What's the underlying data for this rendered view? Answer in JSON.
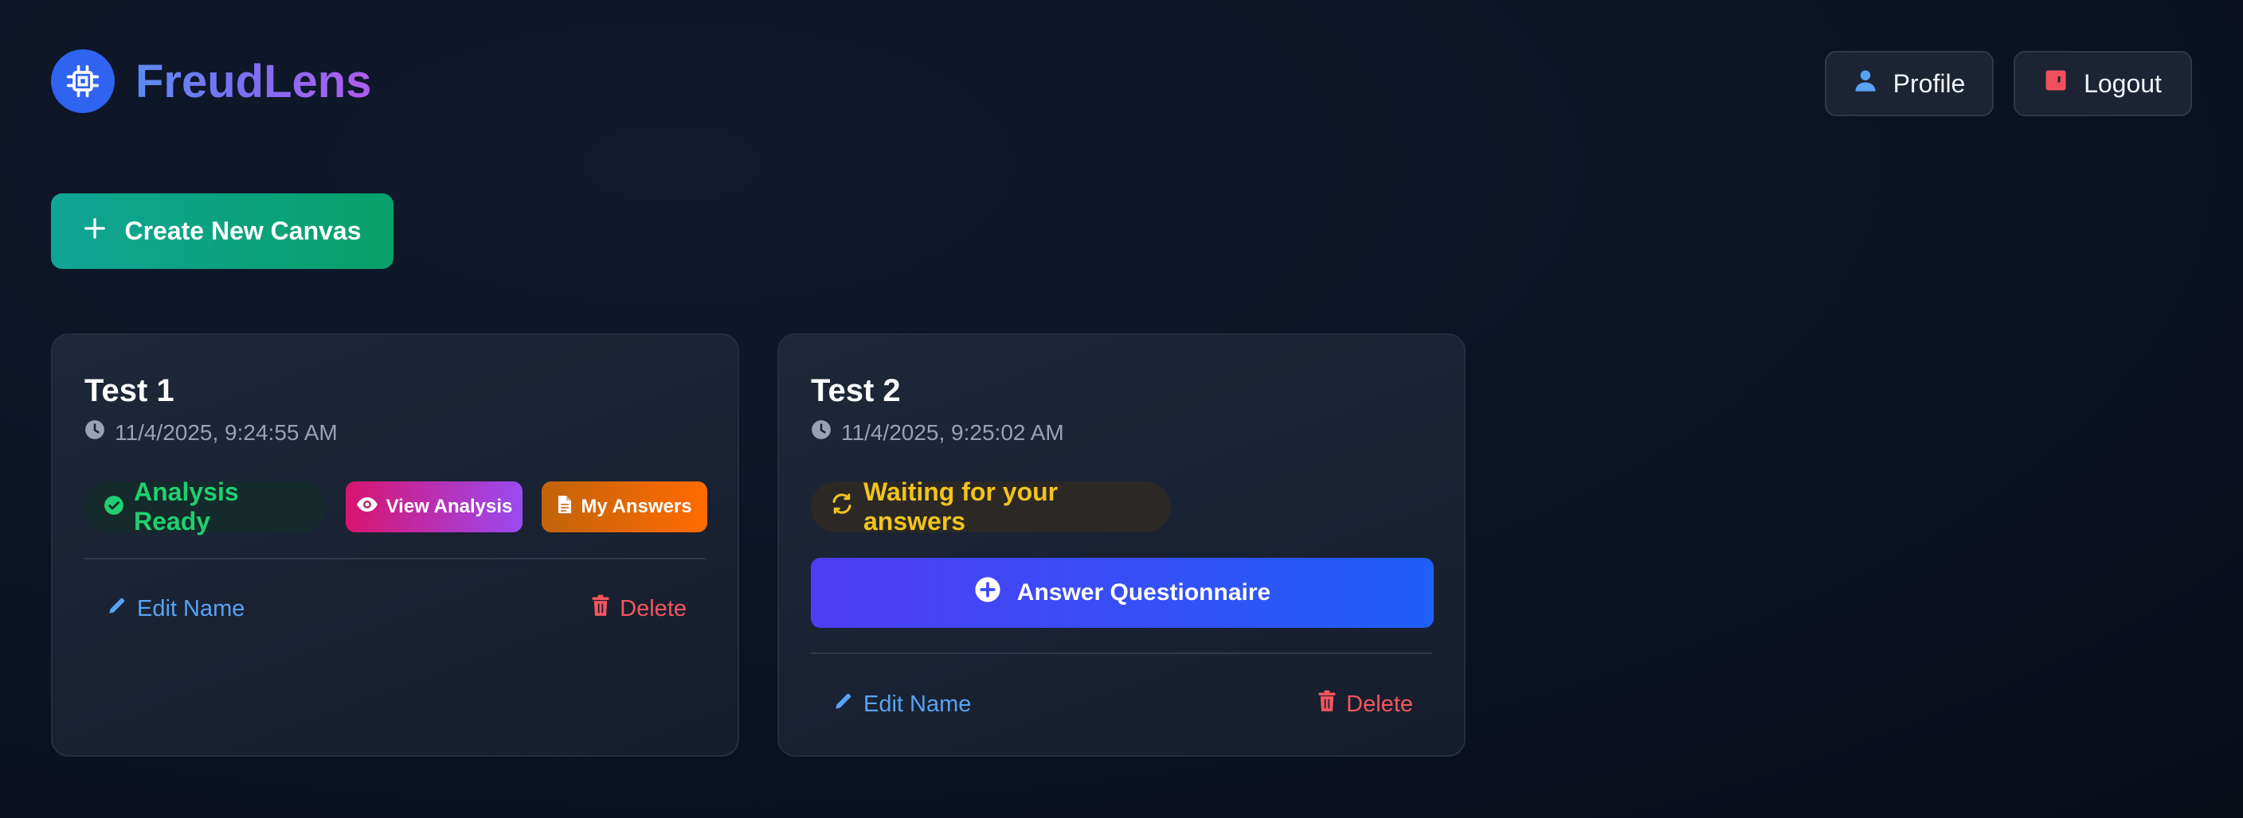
{
  "app": {
    "brand": "FreudLens",
    "logo_icon": "cpu-chip-icon"
  },
  "header": {
    "profile_label": "Profile",
    "logout_label": "Logout"
  },
  "toolbar": {
    "create_label": "Create New Canvas"
  },
  "colors": {
    "accent_blue": "#2f63f0",
    "success_green": "#1fcf71",
    "warning_yellow": "#f2c41b",
    "danger_red": "#f5565d",
    "link_blue": "#58a3f5"
  },
  "canvases": [
    {
      "title": "Test 1",
      "date": "11/4/2025, 9:24:55 AM",
      "status": "Analysis Ready",
      "status_icon": "check-circle-icon",
      "view_analysis_label": "View Analysis",
      "my_answers_label": "My Answers",
      "edit_label": "Edit Name",
      "delete_label": "Delete"
    },
    {
      "title": "Test 2",
      "date": "11/4/2025, 9:25:02 AM",
      "status": "Waiting for your answers",
      "status_icon": "sync-icon",
      "answer_label": "Answer Questionnaire",
      "edit_label": "Edit Name",
      "delete_label": "Delete"
    }
  ]
}
